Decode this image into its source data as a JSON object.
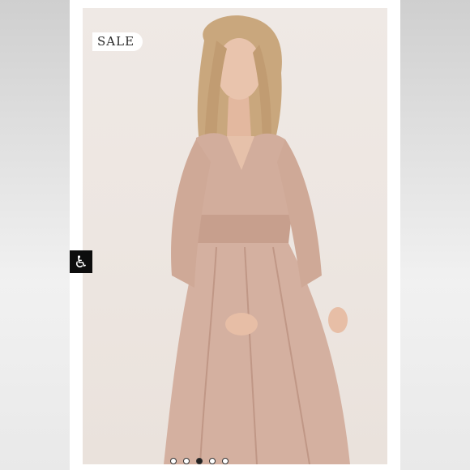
{
  "badge": {
    "label": "SALE"
  },
  "accessibility": {
    "icon": "wheelchair-icon",
    "glyph": "♿"
  },
  "carousel": {
    "slide_count": 5,
    "active_index": 2
  },
  "colors": {
    "backdrop": "#efe9e5",
    "dress": "#d2ad9c",
    "hair": "#c9a77d",
    "skin": "#e9c4ad",
    "badge_bg": "#ffffff",
    "a11y_bg": "#0d0d0d"
  }
}
